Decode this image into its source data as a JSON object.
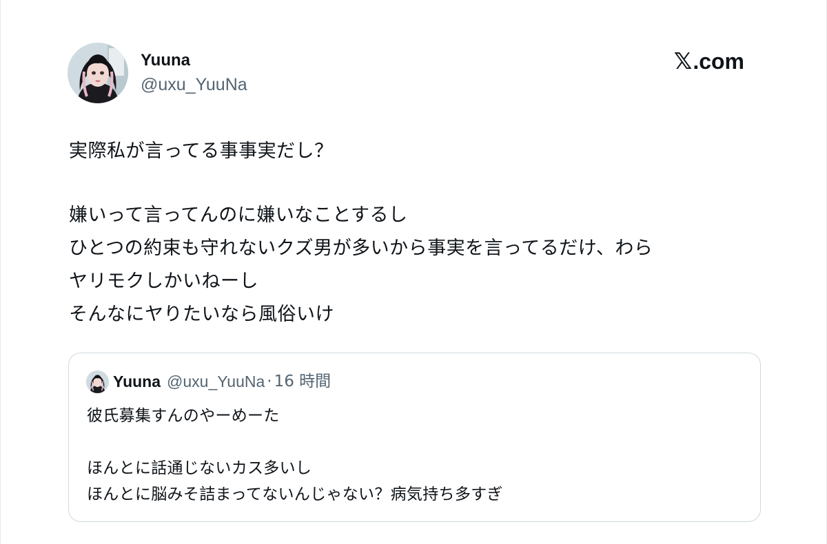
{
  "tweet": {
    "author": {
      "name": "Yuuna",
      "handle": "@uxu_YuuNa"
    },
    "brand": {
      "icon": "x-logo-icon",
      "label": ".com",
      "glyph": "𝕏"
    },
    "text": {
      "line1": "実際私が言ってる事事実だし？",
      "line2": "嫌いって言ってんのに嫌いなことするし",
      "line3": "ひとつの約束も守れないクズ男が多いから事実を言ってるだけ、わら",
      "line4": "ヤリモクしかいねーし",
      "line5": "そんなにヤりたいなら風俗いけ"
    },
    "quoted": {
      "name": "Yuuna",
      "handle": "@uxu_YuuNa",
      "separator": "·",
      "time": "16 時間",
      "text": {
        "line1": "彼氏募集すんのやーめーた",
        "line2": "ほんとに話通じないカス多いし",
        "line3": "ほんとに脳みそ詰まってないんじゃない？病気持ち多すぎ"
      }
    }
  },
  "colors": {
    "text_primary": "#0f1419",
    "text_secondary": "#536471",
    "card_border": "#cfd9de"
  }
}
